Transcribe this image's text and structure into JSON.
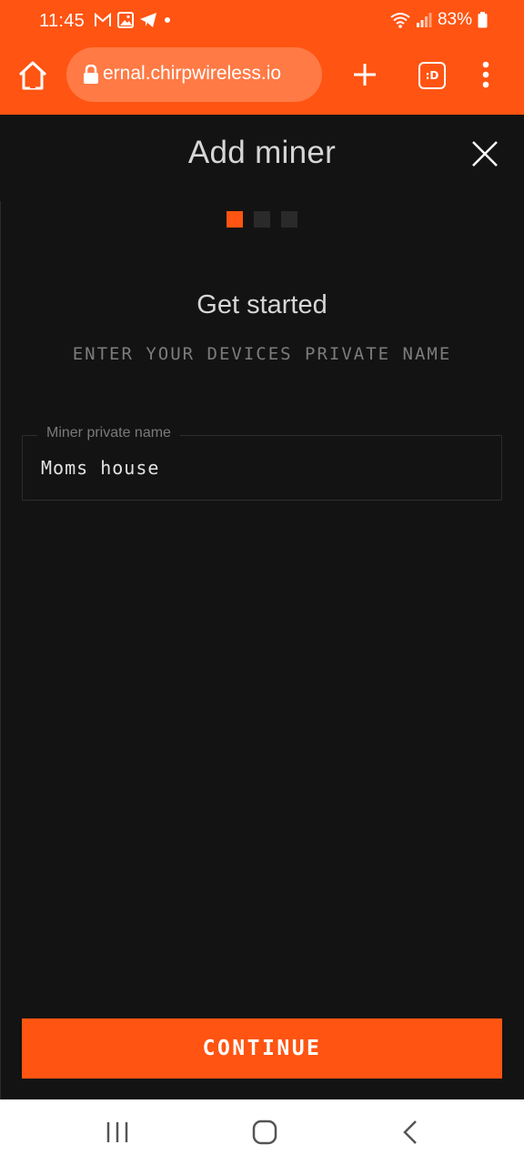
{
  "status_bar": {
    "time": "11:45",
    "battery": "83%",
    "notification_icons": [
      "gmail-icon",
      "gallery-icon",
      "telegram-icon",
      "dot-icon"
    ],
    "system_icons": [
      "wifi-icon",
      "signal-icon",
      "battery-icon"
    ]
  },
  "browser": {
    "url": "ernal.chirpwireless.io",
    "tab_count_label": ":D",
    "toolbar_icons": [
      "home-icon",
      "lock-icon",
      "plus-icon",
      "tabs-icon",
      "more-vert-icon"
    ]
  },
  "dialog": {
    "title": "Add miner",
    "close_icon": "close-icon",
    "steps": {
      "total": 3,
      "current": 1
    },
    "heading": "Get started",
    "subheading": "ENTER YOUR DEVICES PRIVATE NAME",
    "field": {
      "label": "Miner private name",
      "value": "Moms house"
    },
    "continue_label": "CONTINUE"
  },
  "nav_bar": {
    "icons": [
      "recents-icon",
      "home-circle-icon",
      "back-icon"
    ]
  },
  "colors": {
    "accent": "#ff5412",
    "background": "#131313",
    "text": "#d6d6d6",
    "muted": "#7c7c7c"
  }
}
